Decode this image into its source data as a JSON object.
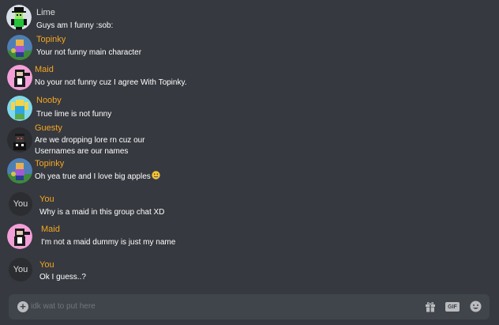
{
  "messages": [
    {
      "author": "Lime",
      "text": "Guys am I funny :sob:"
    },
    {
      "author": "Topinky",
      "text": "Your not funny main character"
    },
    {
      "author": "Maid",
      "text": "No your not funny cuz I agree With Topinky."
    },
    {
      "author": "Nooby",
      "text": "True lime is not funny"
    },
    {
      "author": "Guesty",
      "text_line1": "Are we dropping lore rn cuz our",
      "text_line2": "Usernames are our names"
    },
    {
      "author": "Topinky",
      "text": "Oh yea true and I love big apples"
    },
    {
      "author": "You",
      "avatar_text": "You",
      "text": "Why is a maid in this group chat XD"
    },
    {
      "author": "Maid",
      "text": "I'm not a maid dummy is just my name"
    },
    {
      "author": "You",
      "avatar_text": "You",
      "text": "Ok I guess..?"
    }
  ],
  "composer": {
    "placeholder": "idk wat to put here",
    "gif_label": "GIF",
    "icons": [
      "add-icon",
      "gift-icon",
      "gif-icon",
      "emoji-icon"
    ]
  },
  "colors": {
    "background": "#36393f",
    "composer": "#40444b",
    "author_highlight": "#f5a623",
    "text": "#ffffff"
  }
}
